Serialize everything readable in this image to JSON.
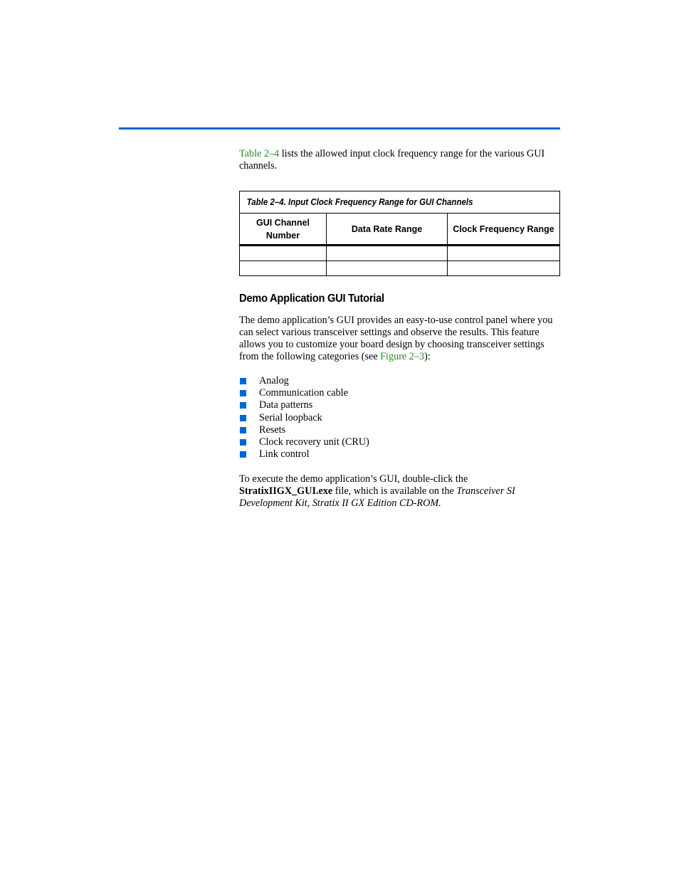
{
  "header": {
    "rule_color": "#0066cc"
  },
  "intro": {
    "link": "Table 2–4",
    "text": " lists the allowed input clock frequency range for the various GUI channels."
  },
  "table": {
    "caption": "Table 2–4. Input Clock Frequency Range for GUI Channels",
    "columns": [
      "GUI Channel Number",
      "Data Rate Range",
      "Clock Frequency Range"
    ],
    "column_lines": [
      [
        "GUI Channel",
        "Number"
      ],
      [
        "Data Rate Range"
      ],
      [
        "Clock Frequency Range"
      ]
    ],
    "rows": [
      [
        "",
        "",
        ""
      ],
      [
        "",
        "",
        ""
      ]
    ]
  },
  "section": {
    "heading": "Demo Application GUI Tutorial",
    "para_text": "The demo application’s GUI provides an easy-to-use control panel where you can select various transceiver settings and observe the results. This feature allows you to customize your board design by choosing transceiver settings from the following categories (see ",
    "para_link": "Figure 2–3",
    "para_end": "):",
    "bullets": [
      "Analog",
      "Communication cable",
      "Data patterns",
      "Serial loopback",
      "Resets",
      "Clock recovery unit (CRU)",
      "Link control"
    ]
  },
  "execute": {
    "text1": "To execute the demo application’s GUI, double-click the ",
    "filename": "StratixIIGX_GUI.exe",
    "text2": " file, which is available on the ",
    "cdrom": "Transceiver SI Development Kit, Stratix II GX Edition CD-ROM",
    "end": "."
  }
}
